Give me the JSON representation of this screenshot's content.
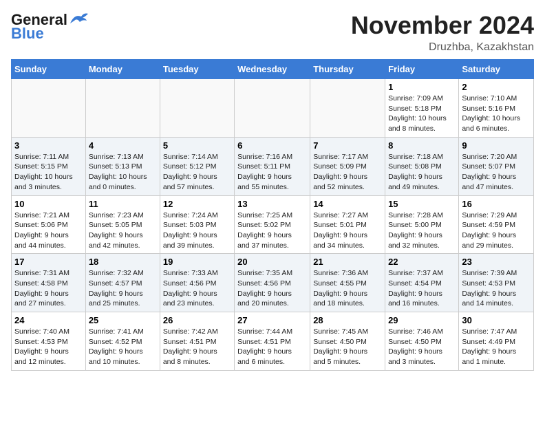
{
  "logo": {
    "general": "General",
    "blue": "Blue"
  },
  "title": "November 2024",
  "location": "Druzhba, Kazakhstan",
  "days_of_week": [
    "Sunday",
    "Monday",
    "Tuesday",
    "Wednesday",
    "Thursday",
    "Friday",
    "Saturday"
  ],
  "weeks": [
    [
      {
        "day": "",
        "info": ""
      },
      {
        "day": "",
        "info": ""
      },
      {
        "day": "",
        "info": ""
      },
      {
        "day": "",
        "info": ""
      },
      {
        "day": "",
        "info": ""
      },
      {
        "day": "1",
        "info": "Sunrise: 7:09 AM\nSunset: 5:18 PM\nDaylight: 10 hours\nand 8 minutes."
      },
      {
        "day": "2",
        "info": "Sunrise: 7:10 AM\nSunset: 5:16 PM\nDaylight: 10 hours\nand 6 minutes."
      }
    ],
    [
      {
        "day": "3",
        "info": "Sunrise: 7:11 AM\nSunset: 5:15 PM\nDaylight: 10 hours\nand 3 minutes."
      },
      {
        "day": "4",
        "info": "Sunrise: 7:13 AM\nSunset: 5:13 PM\nDaylight: 10 hours\nand 0 minutes."
      },
      {
        "day": "5",
        "info": "Sunrise: 7:14 AM\nSunset: 5:12 PM\nDaylight: 9 hours\nand 57 minutes."
      },
      {
        "day": "6",
        "info": "Sunrise: 7:16 AM\nSunset: 5:11 PM\nDaylight: 9 hours\nand 55 minutes."
      },
      {
        "day": "7",
        "info": "Sunrise: 7:17 AM\nSunset: 5:09 PM\nDaylight: 9 hours\nand 52 minutes."
      },
      {
        "day": "8",
        "info": "Sunrise: 7:18 AM\nSunset: 5:08 PM\nDaylight: 9 hours\nand 49 minutes."
      },
      {
        "day": "9",
        "info": "Sunrise: 7:20 AM\nSunset: 5:07 PM\nDaylight: 9 hours\nand 47 minutes."
      }
    ],
    [
      {
        "day": "10",
        "info": "Sunrise: 7:21 AM\nSunset: 5:06 PM\nDaylight: 9 hours\nand 44 minutes."
      },
      {
        "day": "11",
        "info": "Sunrise: 7:23 AM\nSunset: 5:05 PM\nDaylight: 9 hours\nand 42 minutes."
      },
      {
        "day": "12",
        "info": "Sunrise: 7:24 AM\nSunset: 5:03 PM\nDaylight: 9 hours\nand 39 minutes."
      },
      {
        "day": "13",
        "info": "Sunrise: 7:25 AM\nSunset: 5:02 PM\nDaylight: 9 hours\nand 37 minutes."
      },
      {
        "day": "14",
        "info": "Sunrise: 7:27 AM\nSunset: 5:01 PM\nDaylight: 9 hours\nand 34 minutes."
      },
      {
        "day": "15",
        "info": "Sunrise: 7:28 AM\nSunset: 5:00 PM\nDaylight: 9 hours\nand 32 minutes."
      },
      {
        "day": "16",
        "info": "Sunrise: 7:29 AM\nSunset: 4:59 PM\nDaylight: 9 hours\nand 29 minutes."
      }
    ],
    [
      {
        "day": "17",
        "info": "Sunrise: 7:31 AM\nSunset: 4:58 PM\nDaylight: 9 hours\nand 27 minutes."
      },
      {
        "day": "18",
        "info": "Sunrise: 7:32 AM\nSunset: 4:57 PM\nDaylight: 9 hours\nand 25 minutes."
      },
      {
        "day": "19",
        "info": "Sunrise: 7:33 AM\nSunset: 4:56 PM\nDaylight: 9 hours\nand 23 minutes."
      },
      {
        "day": "20",
        "info": "Sunrise: 7:35 AM\nSunset: 4:56 PM\nDaylight: 9 hours\nand 20 minutes."
      },
      {
        "day": "21",
        "info": "Sunrise: 7:36 AM\nSunset: 4:55 PM\nDaylight: 9 hours\nand 18 minutes."
      },
      {
        "day": "22",
        "info": "Sunrise: 7:37 AM\nSunset: 4:54 PM\nDaylight: 9 hours\nand 16 minutes."
      },
      {
        "day": "23",
        "info": "Sunrise: 7:39 AM\nSunset: 4:53 PM\nDaylight: 9 hours\nand 14 minutes."
      }
    ],
    [
      {
        "day": "24",
        "info": "Sunrise: 7:40 AM\nSunset: 4:53 PM\nDaylight: 9 hours\nand 12 minutes."
      },
      {
        "day": "25",
        "info": "Sunrise: 7:41 AM\nSunset: 4:52 PM\nDaylight: 9 hours\nand 10 minutes."
      },
      {
        "day": "26",
        "info": "Sunrise: 7:42 AM\nSunset: 4:51 PM\nDaylight: 9 hours\nand 8 minutes."
      },
      {
        "day": "27",
        "info": "Sunrise: 7:44 AM\nSunset: 4:51 PM\nDaylight: 9 hours\nand 6 minutes."
      },
      {
        "day": "28",
        "info": "Sunrise: 7:45 AM\nSunset: 4:50 PM\nDaylight: 9 hours\nand 5 minutes."
      },
      {
        "day": "29",
        "info": "Sunrise: 7:46 AM\nSunset: 4:50 PM\nDaylight: 9 hours\nand 3 minutes."
      },
      {
        "day": "30",
        "info": "Sunrise: 7:47 AM\nSunset: 4:49 PM\nDaylight: 9 hours\nand 1 minute."
      }
    ]
  ]
}
